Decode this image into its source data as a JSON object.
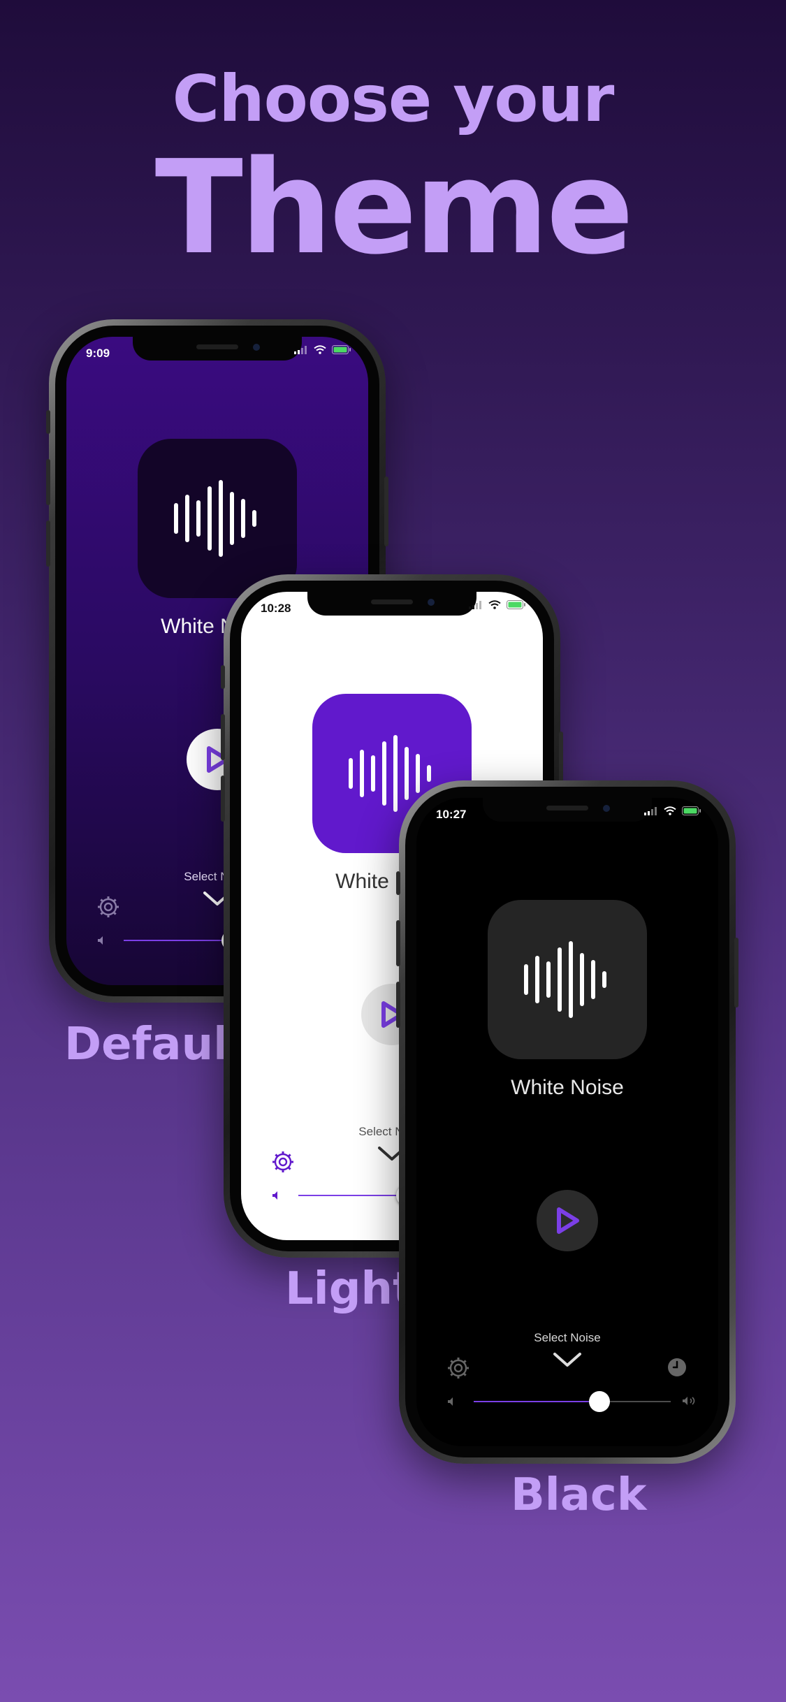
{
  "headline": {
    "line1": "Choose your",
    "line2": "Theme"
  },
  "colors": {
    "accent": "#c39ef6",
    "purple": "#6119cc",
    "battery_green": "#4cd964"
  },
  "themes": [
    {
      "id": "default",
      "caption": "Default",
      "time": "9:09",
      "noise_name": "White Noise",
      "select_label": "Select Noise",
      "volume": 0.55
    },
    {
      "id": "light",
      "caption": "Light",
      "time": "10:28",
      "noise_name": "White Noise",
      "select_label": "Select Noise",
      "volume": 0.55
    },
    {
      "id": "black",
      "caption": "Black",
      "time": "10:27",
      "noise_name": "White Noise",
      "select_label": "Select Noise",
      "volume": 0.64
    }
  ],
  "icons": {
    "waveform": "waveform-icon",
    "play": "play-icon",
    "chevron": "chevron-down-icon",
    "settings": "gear-icon",
    "timer": "clock-icon",
    "volume_low": "speaker-low-icon",
    "volume_high": "speaker-high-icon"
  }
}
